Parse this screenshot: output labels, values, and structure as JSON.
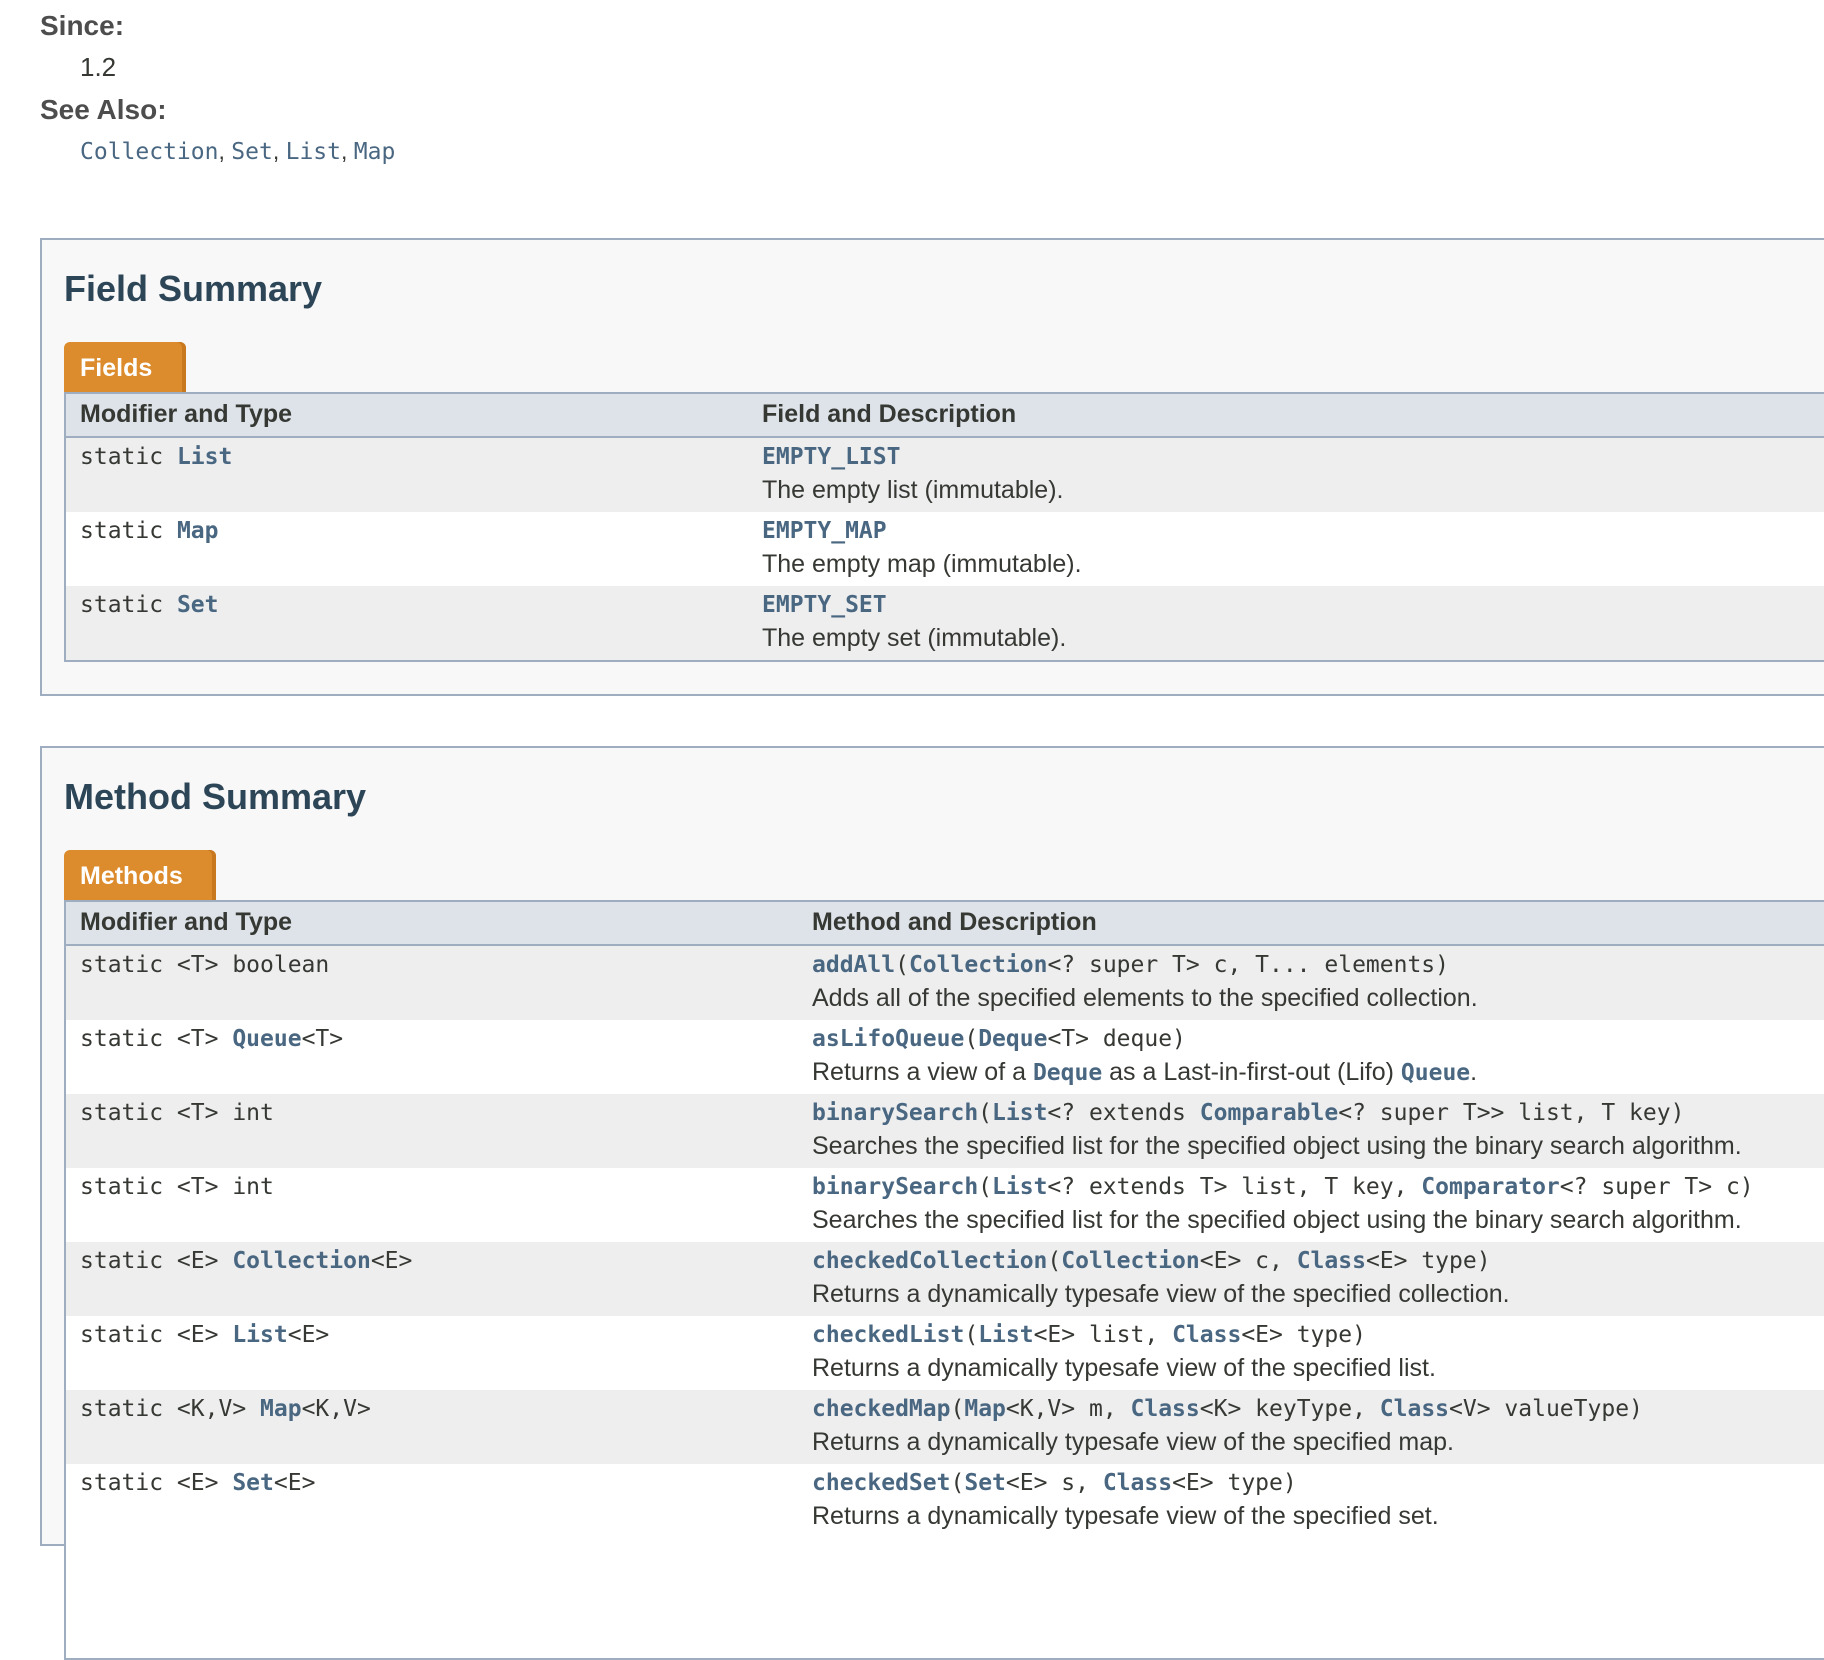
{
  "since": {
    "label": "Since:",
    "value": "1.2"
  },
  "see_also": {
    "label": "See Also:",
    "links": [
      "Collection",
      "Set",
      "List",
      "Map"
    ],
    "sep": ", "
  },
  "field_summary": {
    "title": "Field Summary",
    "tab": "Fields",
    "col1": "Modifier and Type",
    "col2": "Field and Description",
    "rows": [
      {
        "modifier": "static ",
        "type": "List",
        "name": "EMPTY_LIST",
        "desc": "The empty list (immutable)."
      },
      {
        "modifier": "static ",
        "type": "Map",
        "name": "EMPTY_MAP",
        "desc": "The empty map (immutable)."
      },
      {
        "modifier": "static ",
        "type": "Set",
        "name": "EMPTY_SET",
        "desc": "The empty set (immutable)."
      }
    ]
  },
  "method_summary": {
    "title": "Method Summary",
    "tab": "Methods",
    "col1": "Modifier and Type",
    "col2": "Method and Description",
    "rows": [
      {
        "mod": [
          {
            "t": "static <T> boolean"
          }
        ],
        "sig": [
          {
            "t": "addAll",
            "l": 1
          },
          {
            "t": "("
          },
          {
            "t": "Collection",
            "l": 1
          },
          {
            "t": "<? super T> c, T... elements)"
          }
        ],
        "desc": [
          {
            "t": "Adds all of the specified elements to the specified collection."
          }
        ]
      },
      {
        "mod": [
          {
            "t": "static <T> "
          },
          {
            "t": "Queue",
            "l": 1
          },
          {
            "t": "<T>"
          }
        ],
        "sig": [
          {
            "t": "asLifoQueue",
            "l": 1
          },
          {
            "t": "("
          },
          {
            "t": "Deque",
            "l": 1
          },
          {
            "t": "<T> deque)"
          }
        ],
        "desc": [
          {
            "t": "Returns a view of a "
          },
          {
            "t": "Deque",
            "l": 1
          },
          {
            "t": " as a Last-in-first-out (Lifo) "
          },
          {
            "t": "Queue",
            "l": 1
          },
          {
            "t": "."
          }
        ]
      },
      {
        "mod": [
          {
            "t": "static <T> int"
          }
        ],
        "sig": [
          {
            "t": "binarySearch",
            "l": 1
          },
          {
            "t": "("
          },
          {
            "t": "List",
            "l": 1
          },
          {
            "t": "<? extends "
          },
          {
            "t": "Comparable",
            "l": 1
          },
          {
            "t": "<? super T>> list, T key)"
          }
        ],
        "desc": [
          {
            "t": "Searches the specified list for the specified object using the binary search algorithm."
          }
        ]
      },
      {
        "mod": [
          {
            "t": "static <T> int"
          }
        ],
        "sig": [
          {
            "t": "binarySearch",
            "l": 1
          },
          {
            "t": "("
          },
          {
            "t": "List",
            "l": 1
          },
          {
            "t": "<? extends T> list, T key, "
          },
          {
            "t": "Comparator",
            "l": 1
          },
          {
            "t": "<? super T> c)"
          }
        ],
        "desc": [
          {
            "t": "Searches the specified list for the specified object using the binary search algorithm."
          }
        ]
      },
      {
        "mod": [
          {
            "t": "static <E> "
          },
          {
            "t": "Collection",
            "l": 1
          },
          {
            "t": "<E>"
          }
        ],
        "sig": [
          {
            "t": "checkedCollection",
            "l": 1
          },
          {
            "t": "("
          },
          {
            "t": "Collection",
            "l": 1
          },
          {
            "t": "<E> c, "
          },
          {
            "t": "Class",
            "l": 1
          },
          {
            "t": "<E> type)"
          }
        ],
        "desc": [
          {
            "t": "Returns a dynamically typesafe view of the specified collection."
          }
        ]
      },
      {
        "mod": [
          {
            "t": "static <E> "
          },
          {
            "t": "List",
            "l": 1
          },
          {
            "t": "<E>"
          }
        ],
        "sig": [
          {
            "t": "checkedList",
            "l": 1
          },
          {
            "t": "("
          },
          {
            "t": "List",
            "l": 1
          },
          {
            "t": "<E> list, "
          },
          {
            "t": "Class",
            "l": 1
          },
          {
            "t": "<E> type)"
          }
        ],
        "desc": [
          {
            "t": "Returns a dynamically typesafe view of the specified list."
          }
        ]
      },
      {
        "mod": [
          {
            "t": "static <K,V> "
          },
          {
            "t": "Map",
            "l": 1
          },
          {
            "t": "<K,V>"
          }
        ],
        "sig": [
          {
            "t": "checkedMap",
            "l": 1
          },
          {
            "t": "("
          },
          {
            "t": "Map",
            "l": 1
          },
          {
            "t": "<K,V> m, "
          },
          {
            "t": "Class",
            "l": 1
          },
          {
            "t": "<K> keyType, "
          },
          {
            "t": "Class",
            "l": 1
          },
          {
            "t": "<V> valueType)"
          }
        ],
        "desc": [
          {
            "t": "Returns a dynamically typesafe view of the specified map."
          }
        ]
      },
      {
        "mod": [
          {
            "t": "static <E> "
          },
          {
            "t": "Set",
            "l": 1
          },
          {
            "t": "<E>"
          }
        ],
        "sig": [
          {
            "t": "checkedSet",
            "l": 1
          },
          {
            "t": "("
          },
          {
            "t": "Set",
            "l": 1
          },
          {
            "t": "<E> s, "
          },
          {
            "t": "Class",
            "l": 1
          },
          {
            "t": "<E> type)"
          }
        ],
        "desc": [
          {
            "t": "Returns a dynamically typesafe view of the specified set."
          }
        ]
      }
    ]
  },
  "colors": {
    "link": "#4a6782",
    "tab": "#dc8c2c",
    "header_bg": "#dee3e9",
    "border": "#9eadc0"
  }
}
